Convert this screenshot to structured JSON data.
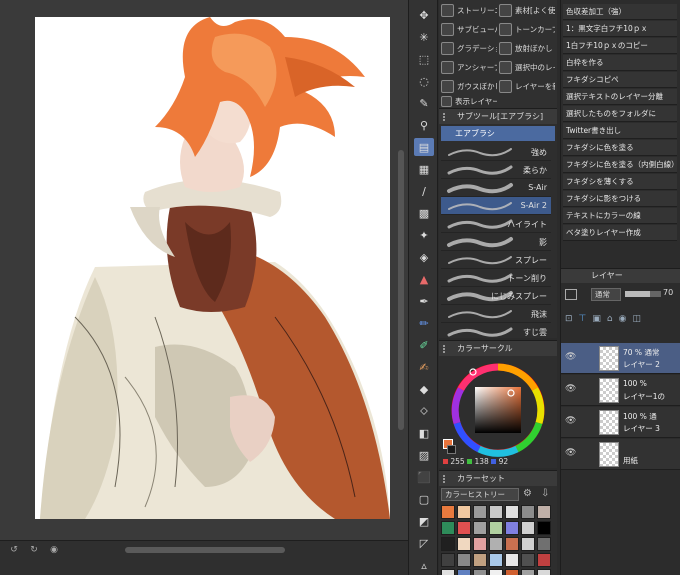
{
  "subtools": [
    {
      "label": "ストーリーエ"
    },
    {
      "label": "素材[よく使う"
    },
    {
      "label": "サブビューパ"
    },
    {
      "label": "トーンカーブ"
    },
    {
      "label": "グラデーショ"
    },
    {
      "label": "放射ぼかし"
    },
    {
      "label": "アンシャープ"
    },
    {
      "label": "選択中のレイ"
    },
    {
      "label": "ガウスぼかし"
    },
    {
      "label": "レイヤーを新"
    },
    {
      "label": "表示レイヤー"
    }
  ],
  "subtool_panel": {
    "title": "サブツール[エアブラシ]",
    "selected": "エアブラシ",
    "brushes": [
      {
        "label": "強め"
      },
      {
        "label": "柔らか"
      },
      {
        "label": "S-Air"
      },
      {
        "label": "S-Air 2",
        "selected": true
      },
      {
        "label": "ハイライト"
      },
      {
        "label": "影"
      },
      {
        "label": "スプレー"
      },
      {
        "label": "トーン削り"
      },
      {
        "label": "にじみスプレー"
      },
      {
        "label": "飛沫"
      },
      {
        "label": "すじ雲"
      }
    ]
  },
  "color_circle": {
    "title": "カラーサークル",
    "values": {
      "r": "255",
      "g": "138",
      "b": "92"
    },
    "main_color": "#e8743c"
  },
  "color_set": {
    "title": "カラーセット",
    "dropdown": "カラーヒストリー",
    "swatches": [
      "#e87a3e",
      "#f0c8a0",
      "#9a9a9a",
      "#c8c8c8",
      "#e0e0e0",
      "#8c8c8c",
      "#c0b0a8",
      "#2e8c5a",
      "#e05050",
      "#a0a0a0",
      "#b0d0a0",
      "#8080e0",
      "#d0d0d0",
      "#000000",
      "#202020",
      "#f0d8c0",
      "#e0a0a0",
      "#b0b0b0",
      "#c87050",
      "#d0d0d0",
      "#707070",
      "#404040",
      "#888888",
      "#c0a080",
      "#a8c8e8",
      "#e8e8e8",
      "#505050",
      "#c04040",
      "#e0e0e0",
      "#6080c0",
      "#909090",
      "#f0f0f0",
      "#d06030",
      "#a0a0a0",
      "#d8d8d8"
    ]
  },
  "auto_actions": [
    "色収差加工（強）",
    "1：黒文字白フチ10ｐｘ",
    "1白フチ10ｐｘのコピー",
    "白枠を作る",
    "フキダシコピペ",
    "選択テキストのレイヤー分離",
    "選択したものをフォルダに",
    "Twitter書き出し",
    "フキダシに色を塗る",
    "フキダシに色を塗る（内側白線）",
    "フキダシを薄くする",
    "フキダシに影をつける",
    "テキストにカラーの線",
    "ベタ塗りレイヤー作成"
  ],
  "layer_panel": {
    "title": "レイヤー",
    "blend_mode": "通常",
    "opacity": "70",
    "layers": [
      {
        "line1": "70 % 通常",
        "line2": "レイヤー 2",
        "selected": true
      },
      {
        "line1": "100 %",
        "line2": "レイヤー1の"
      },
      {
        "line1": "100 % 通",
        "line2": "レイヤー 3"
      },
      {
        "line1": "",
        "line2": "用紙"
      }
    ]
  }
}
